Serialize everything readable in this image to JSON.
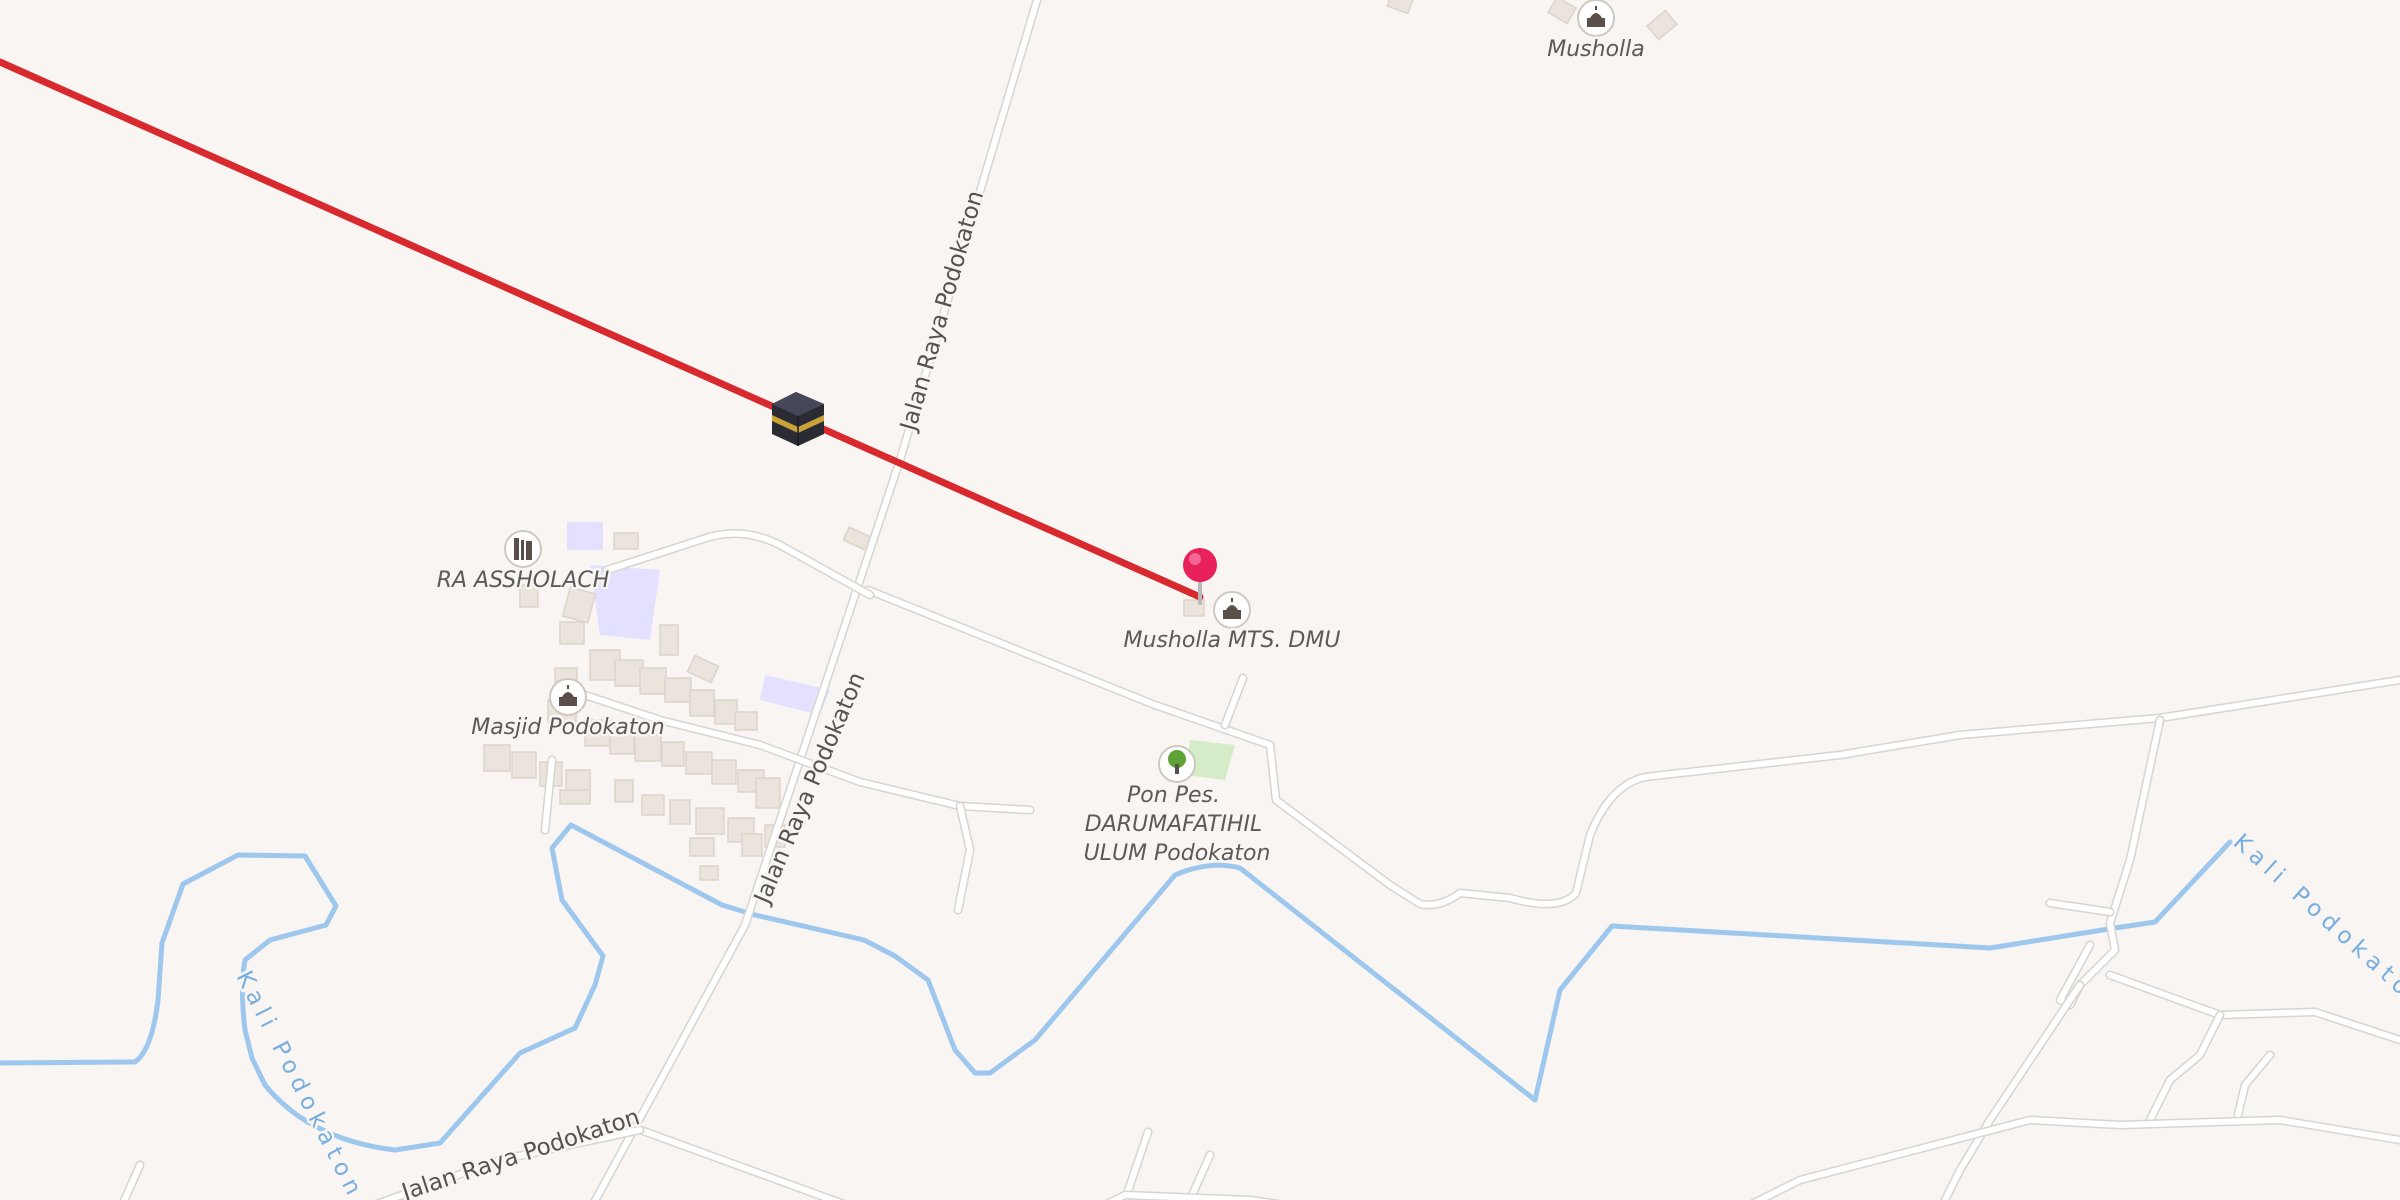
{
  "map": {
    "colors": {
      "background": "#f8f5f2",
      "road": "#ffffff",
      "river": "#9ec7ee",
      "qibla_line": "#d8292e",
      "pin": "#e8215a",
      "landuse_residential": "#e4e0ff",
      "landuse_park": "#d6ebc8"
    },
    "qibla": {
      "icon": "kaaba-icon"
    },
    "pin": {
      "icon": "location-pin-icon"
    },
    "roads": [
      {
        "name": "Jalan Raya Podokaton"
      },
      {
        "name": "Jalan Raya Podokaton"
      },
      {
        "name": "Jalan Raya Podokaton"
      }
    ],
    "rivers": [
      {
        "name": "Kali Podokaton"
      },
      {
        "name": "Kali Podokaton"
      }
    ],
    "pois": [
      {
        "name": "Musholla",
        "icon": "mosque-icon"
      },
      {
        "name": "RA ASSHOLACH",
        "icon": "school-icon"
      },
      {
        "name": "Musholla MTS. DMU",
        "icon": "mosque-icon"
      },
      {
        "name": "Masjid Podokaton",
        "icon": "mosque-icon"
      },
      {
        "name_lines": [
          "Pon Pes.",
          "DARUMAFATIHIL",
          "ULUM Podokaton"
        ],
        "icon": "tree-icon"
      }
    ]
  }
}
